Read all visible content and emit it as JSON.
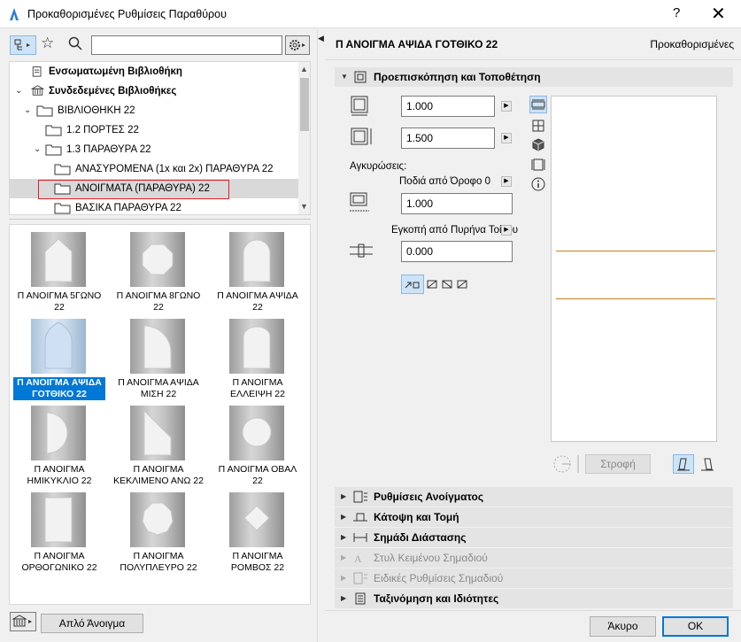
{
  "window": {
    "title": "Προκαθορισμένες Ρυθμίσεις Παραθύρου",
    "help": "?",
    "close": "✕"
  },
  "left": {
    "search": {
      "value": "",
      "placeholder": ""
    },
    "tree": [
      {
        "label": "Ενσωματωμένη Βιβλιοθήκη",
        "bold": true,
        "icon": "library-icon"
      },
      {
        "label": "Συνδεδεμένες Βιβλιοθήκες",
        "bold": true,
        "icon": "library-icon",
        "expanded": true
      },
      {
        "label": "ΒΙΒΛΙΟΘΗΚΗ 22",
        "expanded": true
      },
      {
        "label": "1.2 ΠΟΡΤΕΣ 22"
      },
      {
        "label": "1.3 ΠΑΡΑΘΥΡΑ 22",
        "expanded": true
      },
      {
        "label": "ΑΝΑΣΥΡΟΜΕΝΑ (1x και 2x) ΠΑΡΑΘΥΡΑ 22"
      },
      {
        "label": "ΑΝΟΙΓΜΑΤΑ (ΠΑΡΑΘΥΡΑ) 22",
        "selected": true
      },
      {
        "label": "ΒΑΣΙΚΑ ΠΑΡΑΘΥΡΑ 22"
      }
    ],
    "objects": [
      {
        "line1": "Π ΑΝΟΙΓΜΑ 5ΓΩΝΟ",
        "line2": "22",
        "shape": "pentagon"
      },
      {
        "line1": "Π ΑΝΟΙΓΜΑ 8ΓΩΝΟ",
        "line2": "22",
        "shape": "octagon"
      },
      {
        "line1": "Π ΑΝΟΙΓΜΑ ΑΨΙΔΑ",
        "line2": "22",
        "shape": "arch"
      },
      {
        "line1": "Π ΑΝΟΙΓΜΑ ΑΨΙΔΑ",
        "line2": "ΓΟΤΘΙΚΟ 22",
        "shape": "gothic",
        "selected": true
      },
      {
        "line1": "Π ΑΝΟΙΓΜΑ ΑΨΙΔΑ",
        "line2": "ΜΙΣΗ 22",
        "shape": "half-arch"
      },
      {
        "line1": "Π ΑΝΟΙΓΜΑ",
        "line2": "ΕΛΛΕΙΨΗ 22",
        "shape": "ellipse-top"
      },
      {
        "line1": "Π ΑΝΟΙΓΜΑ",
        "line2": "ΗΜΙΚΥΚΛΙΟ 22",
        "shape": "semicircle"
      },
      {
        "line1": "Π ΑΝΟΙΓΜΑ",
        "line2": "ΚΕΚΛΙΜΕΝΟ ΑΝΩ 22",
        "shape": "slanted"
      },
      {
        "line1": "Π ΑΝΟΙΓΜΑ ΟΒΑΛ",
        "line2": "22",
        "shape": "oval"
      },
      {
        "line1": "Π ΑΝΟΙΓΜΑ",
        "line2": "ΟΡΘΟΓΩΝΙΚΟ 22",
        "shape": "rectangle"
      },
      {
        "line1": "Π ΑΝΟΙΓΜΑ",
        "line2": "ΠΟΛΥΠΛΕΥΡΟ 22",
        "shape": "polygon"
      },
      {
        "line1": "Π ΑΝΟΙΓΜΑ",
        "line2": "ΡΟΜΒΟΣ 22",
        "shape": "rhombus"
      }
    ],
    "simple_opening_button": "Απλό Άνοιγμα"
  },
  "right": {
    "object_name": "Π ΑΝΟΙΓΜΑ ΑΨΙΔΑ ΓΟΤΘΙΚΟ 22",
    "defaults_label": "Προκαθορισμένες",
    "preview_section": "Προεπισκόπηση και Τοποθέτηση",
    "width_value": "1.000",
    "height_value": "1.500",
    "anchors_label": "Αγκυρώσεις:",
    "sill_anchor": "Ποδιά από Όροφο 0",
    "sill_value": "1.000",
    "reveal_anchor": "Εγκοπή από Πυρήνα Τοίχου",
    "reveal_value": "0.000",
    "rotate_button": "Στροφή",
    "sections": [
      {
        "label": "Ρυθμίσεις Ανοίγματος",
        "disabled": false
      },
      {
        "label": "Κάτοψη και Τομή",
        "disabled": false
      },
      {
        "label": "Σημάδι Διάστασης",
        "disabled": false
      },
      {
        "label": "Στυλ Κειμένου Σημαδιού",
        "disabled": true
      },
      {
        "label": "Ειδικές Ρυθμίσεις Σημαδιού",
        "disabled": true
      },
      {
        "label": "Ταξινόμηση και Ιδιότητες",
        "disabled": false
      }
    ],
    "cancel_button": "Άκυρο",
    "ok_button": "OK"
  },
  "colors": {
    "selection_blue": "#0078d7",
    "highlight_red": "#e02020",
    "preview_line": "#c8801a"
  }
}
